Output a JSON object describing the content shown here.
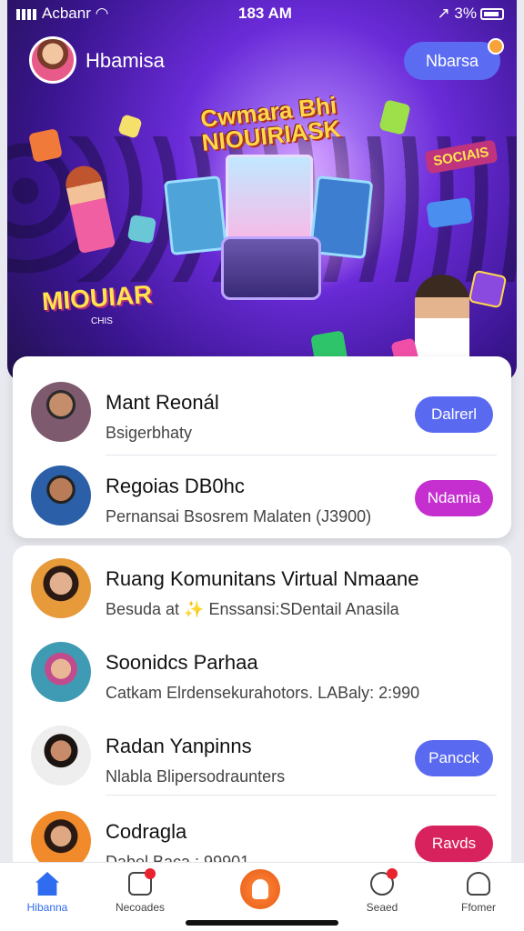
{
  "status_bar": {
    "carrier": "Acbanr",
    "time": "183 AM",
    "battery": "3%"
  },
  "header": {
    "profile_name": "Hbamisa",
    "top_button": "Nbarsa"
  },
  "hero": {
    "game_title_line1": "Cwmara Bhi",
    "game_title_line2": "NIOUIRIASK",
    "logo_left": "MIOUIAR",
    "logo_left_sub": "CHIS",
    "logo_right": "SOCIAIS"
  },
  "list_top": [
    {
      "name": "Mant Reonál",
      "sub": "Bsigerbhaty",
      "button": "Dalrerl",
      "button_color": "#5a6af0"
    },
    {
      "name": "Regoias DB0hc",
      "sub": "Pernansai Bsosrem Malaten (J3900)",
      "button": "Ndamia",
      "button_color": "#c52fd0"
    }
  ],
  "list_main": [
    {
      "name": "Ruang Komunitans Virtual Nmaane",
      "sub": "Besuda at ✨ Enssansi:SDentail Anasila",
      "button": "",
      "button_color": ""
    },
    {
      "name": "Soonidcs Parhaa",
      "sub": "Catkam Elrdensekurahotors. LABaly: 2:990",
      "button": "",
      "button_color": ""
    },
    {
      "name": "Radan Yanpinns",
      "sub": "Nlabla Blipersodraunters",
      "button": "Pancck",
      "button_color": "#5a6af0"
    },
    {
      "name": "Codragla",
      "sub": "Dabel Baca : 99901",
      "button": "Ravds",
      "button_color": "#d8225e"
    }
  ],
  "bottom_nav": [
    {
      "label": "Hibanna",
      "icon": "home-icon",
      "active": true
    },
    {
      "label": "Necoades",
      "icon": "inbox-icon",
      "active": false
    },
    {
      "label": "Seaed",
      "icon": "face-icon",
      "active": false
    },
    {
      "label": "Ffomer",
      "icon": "profile-icon",
      "active": false
    }
  ]
}
